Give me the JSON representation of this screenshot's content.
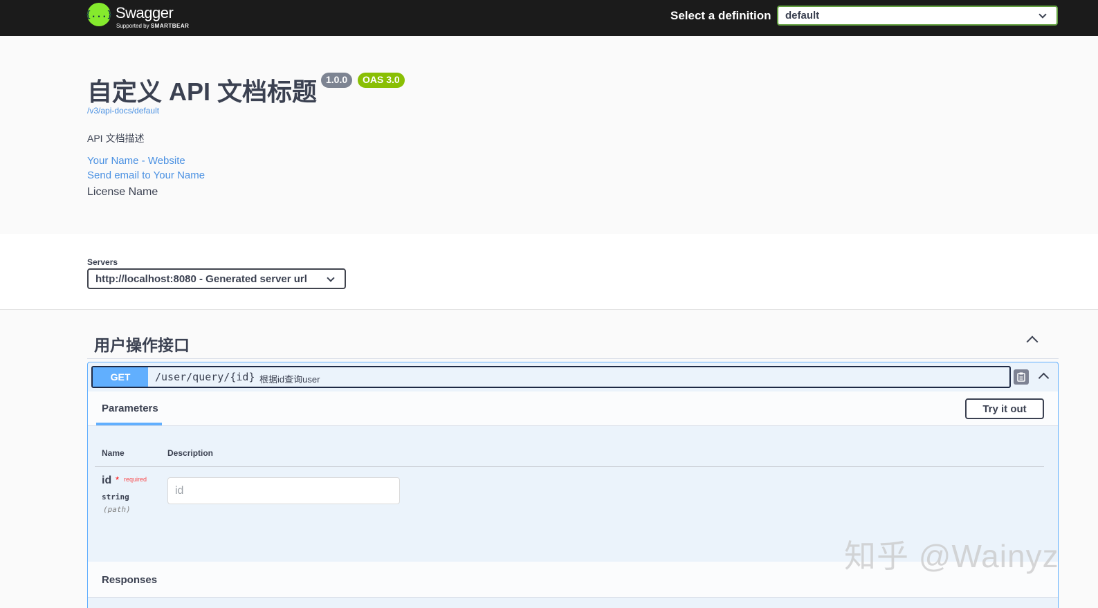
{
  "topbar": {
    "logo_icon_text": "{...}",
    "logo_title": "Swagger",
    "logo_sub_prefix": "Supported by ",
    "logo_sub_brand": "SMARTBEAR",
    "definition_label": "Select a definition",
    "definition_value": "default"
  },
  "info": {
    "title": "自定义 API 文档标题",
    "version": "1.0.0",
    "oas_badge": "OAS 3.0",
    "doc_url": "/v3/api-docs/default",
    "description": "API 文档描述",
    "website_link": "Your Name - Website",
    "email_link": "Send email to Your Name",
    "license": "License Name"
  },
  "servers": {
    "label": "Servers",
    "selected": "http://localhost:8080 - Generated server url"
  },
  "tag": {
    "title": "用户操作接口"
  },
  "operation": {
    "method": "GET",
    "path": "/user/query/{id}",
    "summary": "根据id查询user",
    "copy_icon": "clipboard-icon",
    "parameters_tab": "Parameters",
    "try_button": "Try it out",
    "columns": {
      "name": "Name",
      "description": "Description"
    },
    "param": {
      "name": "id",
      "star": "*",
      "required": "required",
      "type": "string",
      "in": "(path)",
      "placeholder": "id"
    },
    "responses_label": "Responses"
  },
  "watermark": "知乎 @Wainyz",
  "colors": {
    "topbar": "#1b1b1b",
    "logo": "#85ea2d",
    "select_border": "#62a03f",
    "get_method": "#61affe",
    "get_bg": "#ebf3fb",
    "link": "#4990e2",
    "version_badge": "#7d8492",
    "oas_badge": "#89bf04"
  }
}
